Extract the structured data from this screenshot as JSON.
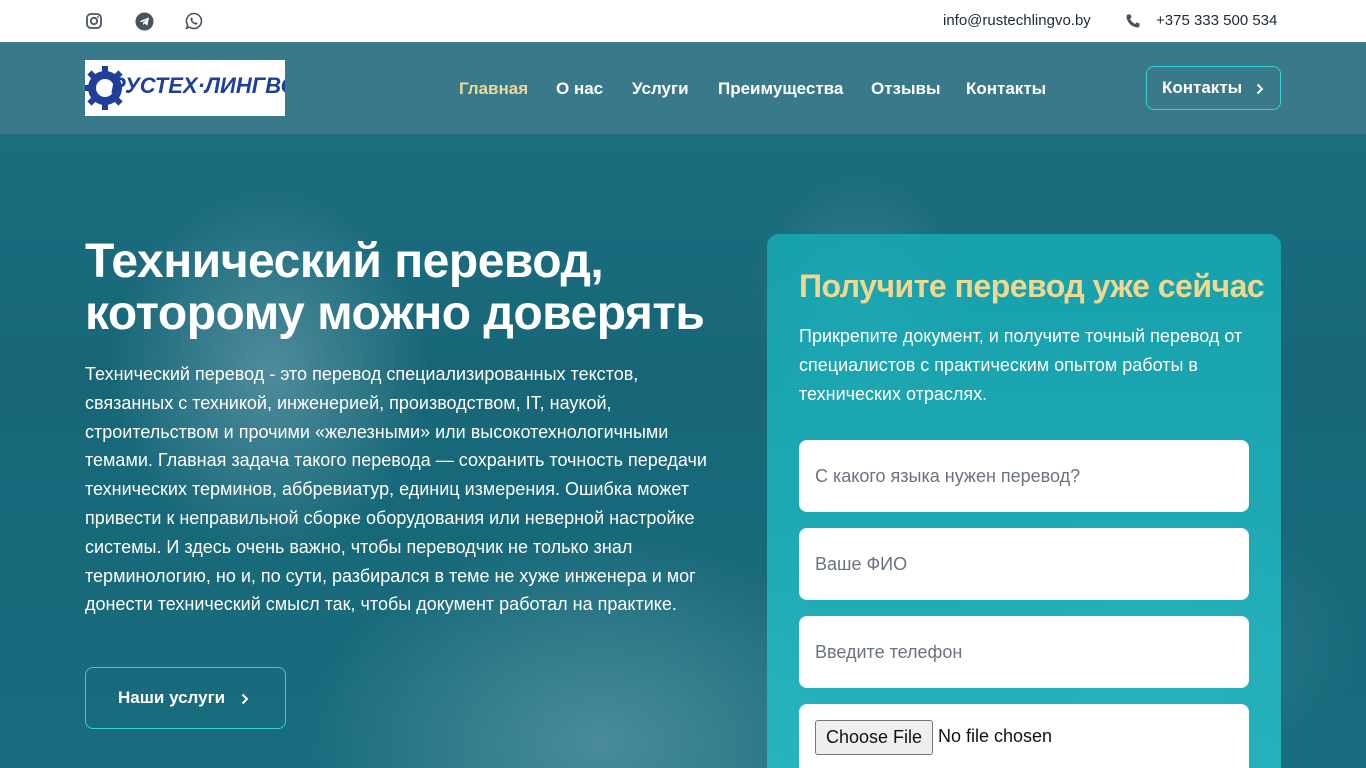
{
  "topbar": {
    "social": [
      {
        "icon": "instagram-icon"
      },
      {
        "icon": "telegram-icon"
      },
      {
        "icon": "whatsapp-icon"
      }
    ],
    "email": "info@rustechlingvo.by",
    "phone": "+375 333 500 534",
    "phone_icon": "phone-icon"
  },
  "nav": {
    "logo_text": "РУСТЕХ·ЛИНГВО",
    "items": [
      {
        "label": "Главная",
        "active": true
      },
      {
        "label": "О нас",
        "active": false
      },
      {
        "label": "Услуги",
        "active": false
      },
      {
        "label": "Преимущества",
        "active": false
      },
      {
        "label": "Отзывы",
        "active": false
      },
      {
        "label": "Контакты",
        "active": false
      }
    ],
    "cta_label": "Контакты"
  },
  "hero": {
    "title": "Технический перевод, которому можно доверять",
    "description": "Технический перевод - это перевод специализированных текстов, связанных с техникой, инженерией, производством, IT, наукой, строительством и прочими «железными» или высокотехнологичными темами. Главная задача такого перевода — сохранить точность передачи технических терминов, аббревиатур, единиц измерения. Ошибка может привести к неправильной сборке оборудования или неверной настройке системы. И здесь очень важно, чтобы переводчик не только знал терминологию, но и, по сути, разбирался в теме не хуже инженера и мог донести технический смысл так, чтобы документ работал на практике.",
    "button_label": "Наши услуги"
  },
  "form": {
    "title": "Получите перевод уже сейчас",
    "text": "Прикрепите документ, и получите точный перевод от специалистов с практическим опытом работы в технических отраслях.",
    "language_placeholder": "С какого языка нужен перевод?",
    "name_placeholder": "Ваше ФИО",
    "phone_placeholder": "Введите телефон",
    "file_button": "Choose File",
    "file_status": "No file chosen"
  },
  "colors": {
    "accent": "#37d0d6",
    "highlight": "#f0d890",
    "text_dark": "#1f2a3a"
  }
}
